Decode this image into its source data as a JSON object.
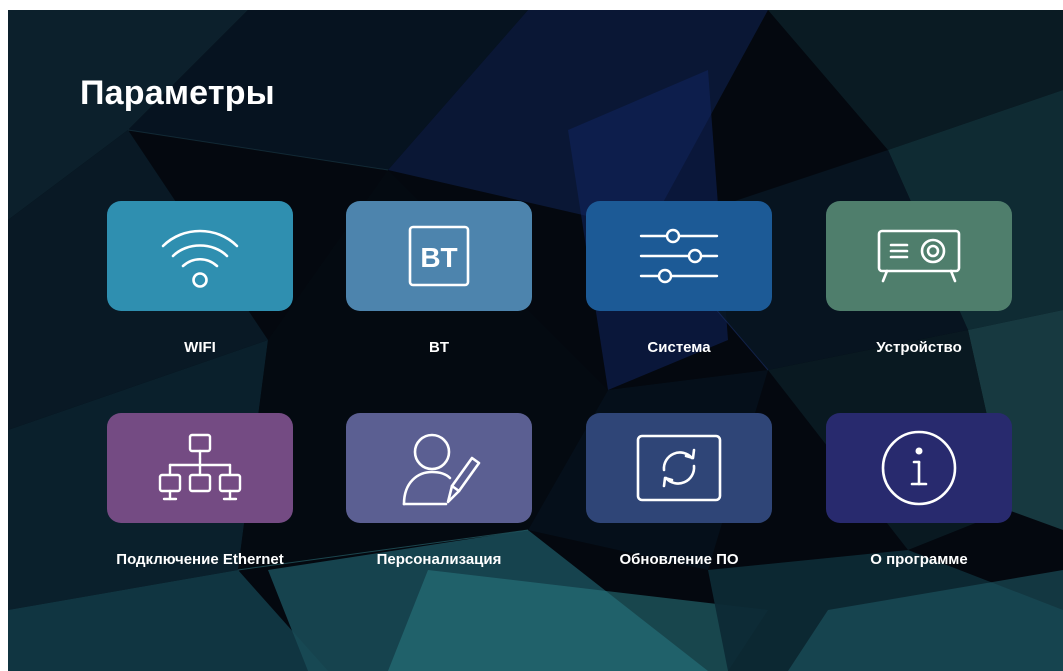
{
  "page": {
    "title": "Параметры"
  },
  "tiles": [
    {
      "label": "WIFI",
      "color": "#2f8fb0",
      "icon": "wifi-icon"
    },
    {
      "label": "BT",
      "color": "#4d84ad",
      "icon": "bluetooth-bt-icon"
    },
    {
      "label": "Система",
      "color": "#1c5a96",
      "icon": "sliders-icon"
    },
    {
      "label": "Устройство",
      "color": "#4f7e6c",
      "icon": "projector-icon"
    },
    {
      "label": "Подключение Ethernet",
      "color": "#744b83",
      "icon": "network-tree-icon"
    },
    {
      "label": "Персонализация",
      "color": "#5b5f92",
      "icon": "user-edit-icon"
    },
    {
      "label": "Обновление ПО",
      "color": "#2f4577",
      "icon": "refresh-update-icon"
    },
    {
      "label": "О программе",
      "color": "#282a6e",
      "icon": "info-icon"
    }
  ]
}
